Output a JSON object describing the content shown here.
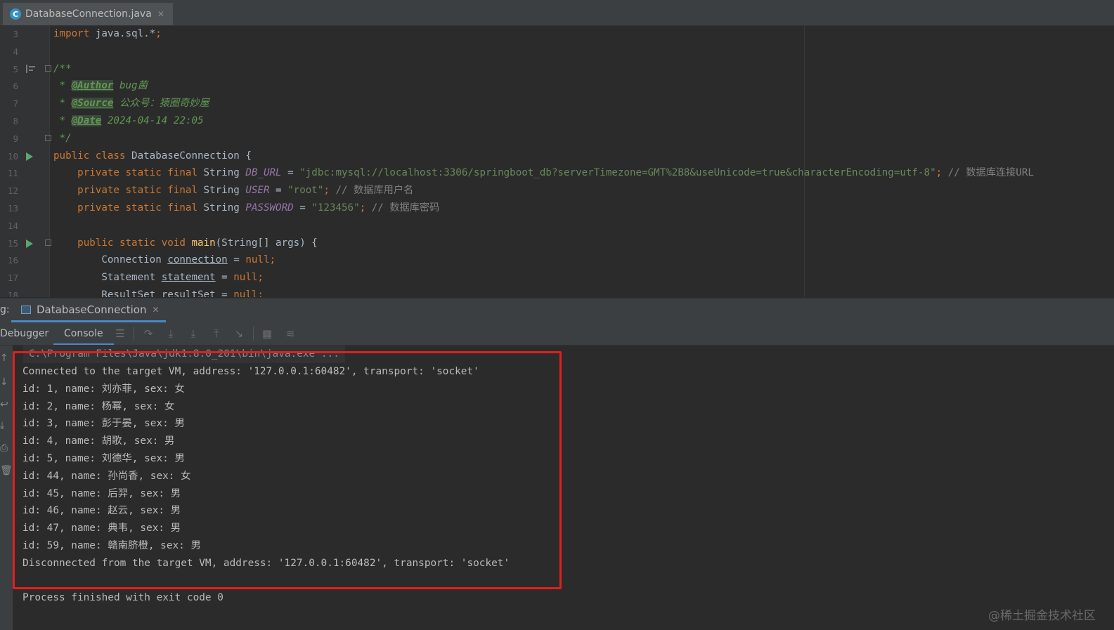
{
  "editor": {
    "tab_title": "DatabaseConnection.java",
    "tab_icon_letter": "C",
    "lines": [
      {
        "n": "3",
        "tokens": [
          {
            "c": "kw",
            "t": "import "
          },
          {
            "c": "plain",
            "t": "java.sql.*"
          },
          {
            "c": "kw",
            "t": ";"
          }
        ]
      },
      {
        "n": "4",
        "tokens": []
      },
      {
        "n": "5",
        "tokens": [
          {
            "c": "cm",
            "t": "/**"
          }
        ]
      },
      {
        "n": "6",
        "tokens": [
          {
            "c": "cm",
            "t": " * "
          },
          {
            "c": "tag",
            "t": "@Author"
          },
          {
            "c": "cm",
            "t": " bug菌"
          }
        ]
      },
      {
        "n": "7",
        "tokens": [
          {
            "c": "cm",
            "t": " * "
          },
          {
            "c": "tag",
            "t": "@Source"
          },
          {
            "c": "cm",
            "t": " 公众号：猿圈奇妙屋"
          }
        ]
      },
      {
        "n": "8",
        "tokens": [
          {
            "c": "cm",
            "t": " * "
          },
          {
            "c": "tag",
            "t": "@Date"
          },
          {
            "c": "cm",
            "t": " 2024-04-14 22:05"
          }
        ]
      },
      {
        "n": "9",
        "tokens": [
          {
            "c": "cm",
            "t": " */"
          }
        ]
      },
      {
        "n": "10",
        "tokens": [
          {
            "c": "kw",
            "t": "public class "
          },
          {
            "c": "plain",
            "t": "DatabaseConnection {"
          }
        ]
      },
      {
        "n": "11",
        "tokens": [
          {
            "c": "kw",
            "t": "    private static final "
          },
          {
            "c": "plain",
            "t": "String "
          },
          {
            "c": "const",
            "t": "DB_URL"
          },
          {
            "c": "plain",
            "t": " = "
          },
          {
            "c": "str",
            "t": "\"jdbc:mysql://localhost:3306/springboot_db?serverTimezone=GMT%2B8&useUnicode=true&characterEncoding=utf-8\""
          },
          {
            "c": "kw",
            "t": ";"
          },
          {
            "c": "lc",
            "t": " // 数据库连接URL"
          }
        ]
      },
      {
        "n": "12",
        "tokens": [
          {
            "c": "kw",
            "t": "    private static final "
          },
          {
            "c": "plain",
            "t": "String "
          },
          {
            "c": "const",
            "t": "USER"
          },
          {
            "c": "plain",
            "t": " = "
          },
          {
            "c": "str",
            "t": "\"root\""
          },
          {
            "c": "kw",
            "t": ";"
          },
          {
            "c": "lc",
            "t": " // 数据库用户名"
          }
        ]
      },
      {
        "n": "13",
        "tokens": [
          {
            "c": "kw",
            "t": "    private static final "
          },
          {
            "c": "plain",
            "t": "String "
          },
          {
            "c": "const",
            "t": "PASSWORD"
          },
          {
            "c": "plain",
            "t": " = "
          },
          {
            "c": "str",
            "t": "\"123456\""
          },
          {
            "c": "kw",
            "t": ";"
          },
          {
            "c": "lc",
            "t": " // 数据库密码"
          }
        ]
      },
      {
        "n": "14",
        "tokens": []
      },
      {
        "n": "15",
        "tokens": [
          {
            "c": "kw",
            "t": "    public static void "
          },
          {
            "c": "fn",
            "t": "main"
          },
          {
            "c": "plain",
            "t": "(String[] args) {"
          }
        ]
      },
      {
        "n": "16",
        "tokens": [
          {
            "c": "plain",
            "t": "        Connection "
          },
          {
            "c": "plain var",
            "t": "connection"
          },
          {
            "c": "plain",
            "t": " = "
          },
          {
            "c": "kw",
            "t": "null;"
          }
        ]
      },
      {
        "n": "17",
        "tokens": [
          {
            "c": "plain",
            "t": "        Statement "
          },
          {
            "c": "plain var",
            "t": "statement"
          },
          {
            "c": "plain",
            "t": " = "
          },
          {
            "c": "kw",
            "t": "null;"
          }
        ]
      },
      {
        "n": "18",
        "tokens": [
          {
            "c": "plain",
            "t": "        ResultSet resultSet = "
          },
          {
            "c": "kw",
            "t": "null;"
          }
        ]
      }
    ]
  },
  "debug_panel": {
    "label": "g:",
    "run_tab": "DatabaseConnection",
    "tabs": [
      "Debugger",
      "Console"
    ],
    "active_tab": "Console"
  },
  "console": {
    "command_line": "C:\\Program Files\\Java\\jdk1.8.0_201\\bin\\java.exe ...",
    "lines": [
      "Connected to the target VM, address: '127.0.0.1:60482', transport: 'socket'",
      "id: 1, name: 刘亦菲, sex: 女",
      "id: 2, name: 杨幂, sex: 女",
      "id: 3, name: 彭于晏, sex: 男",
      "id: 4, name: 胡歌, sex: 男",
      "id: 5, name: 刘德华, sex: 男",
      "id: 44, name: 孙尚香, sex: 女",
      "id: 45, name: 后羿, sex: 男",
      "id: 46, name: 赵云, sex: 男",
      "id: 47, name: 典韦, sex: 男",
      "id: 59, name: 赣南脐橙, sex: 男",
      "Disconnected from the target VM, address: '127.0.0.1:60482', transport: 'socket'",
      "",
      "Process finished with exit code 0"
    ],
    "highlight_color": "#e02020"
  },
  "watermark": "@稀土掘金技术社区"
}
